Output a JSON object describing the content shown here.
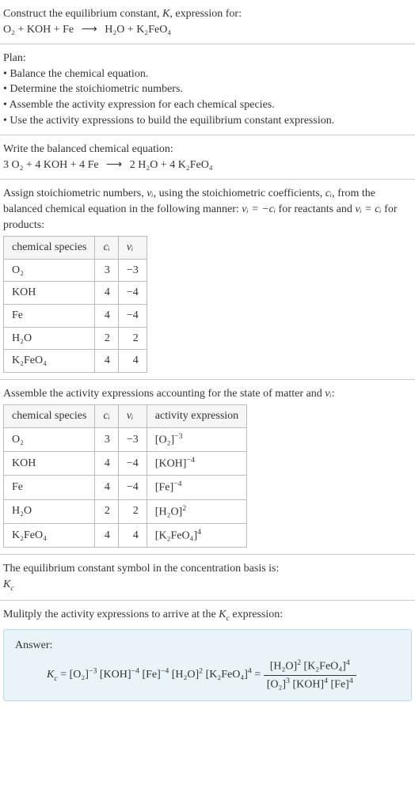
{
  "intro": {
    "line1_a": "Construct the equilibrium constant, ",
    "line1_b": ", expression for:",
    "eq": {
      "left": "O₂ + KOH + Fe",
      "arrow": "⟶",
      "right": "H₂O + K₂FeO₄"
    }
  },
  "plan": {
    "title": "Plan:",
    "items": [
      "• Balance the chemical equation.",
      "• Determine the stoichiometric numbers.",
      "• Assemble the activity expression for each chemical species.",
      "• Use the activity expressions to build the equilibrium constant expression."
    ]
  },
  "balanced": {
    "title": "Write the balanced chemical equation:",
    "eq": {
      "left": "3 O₂ + 4 KOH + 4 Fe",
      "arrow": "⟶",
      "right": "2 H₂O + 4 K₂FeO₄"
    }
  },
  "stoich": {
    "text_a": "Assign stoichiometric numbers, ",
    "text_b": ", using the stoichiometric coefficients, ",
    "text_c": ", from the balanced chemical equation in the following manner: ",
    "text_d": " for reactants and ",
    "text_e": " for products:",
    "nu": "νᵢ",
    "ci": "cᵢ",
    "eq1": "νᵢ = −cᵢ",
    "eq2": "νᵢ = cᵢ",
    "table": {
      "headers": [
        "chemical species",
        "cᵢ",
        "νᵢ"
      ],
      "rows": [
        [
          "O₂",
          "3",
          "−3"
        ],
        [
          "KOH",
          "4",
          "−4"
        ],
        [
          "Fe",
          "4",
          "−4"
        ],
        [
          "H₂O",
          "2",
          "2"
        ],
        [
          "K₂FeO₄",
          "4",
          "4"
        ]
      ]
    }
  },
  "activity": {
    "text_a": "Assemble the activity expressions accounting for the state of matter and ",
    "text_b": ":",
    "nu": "νᵢ",
    "table": {
      "headers": [
        "chemical species",
        "cᵢ",
        "νᵢ",
        "activity expression"
      ],
      "rows": [
        {
          "sp": "O₂",
          "c": "3",
          "v": "−3",
          "act_base": "[O₂]",
          "act_exp": "−3"
        },
        {
          "sp": "KOH",
          "c": "4",
          "v": "−4",
          "act_base": "[KOH]",
          "act_exp": "−4"
        },
        {
          "sp": "Fe",
          "c": "4",
          "v": "−4",
          "act_base": "[Fe]",
          "act_exp": "−4"
        },
        {
          "sp": "H₂O",
          "c": "2",
          "v": "2",
          "act_base": "[H₂O]",
          "act_exp": "2"
        },
        {
          "sp": "K₂FeO₄",
          "c": "4",
          "v": "4",
          "act_base": "[K₂FeO₄]",
          "act_exp": "4"
        }
      ]
    }
  },
  "symbol": {
    "text": "The equilibrium constant symbol in the concentration basis is:",
    "kc": "K",
    "kc_sub": "c"
  },
  "multiply": {
    "text_a": "Mulitply the activity expressions to arrive at the ",
    "text_b": " expression:",
    "kc": "K",
    "kc_sub": "c"
  },
  "answer": {
    "label": "Answer:",
    "kc": "K",
    "kc_sub": "c",
    "eq": " = ",
    "terms": [
      {
        "base": "[O₂]",
        "exp": "−3"
      },
      {
        "base": " [KOH]",
        "exp": "−4"
      },
      {
        "base": " [Fe]",
        "exp": "−4"
      },
      {
        "base": " [H₂O]",
        "exp": "2"
      },
      {
        "base": " [K₂FeO₄]",
        "exp": "4"
      }
    ],
    "eq2": " = ",
    "frac": {
      "num": [
        {
          "base": "[H₂O]",
          "exp": "2"
        },
        {
          "base": " [K₂FeO₄]",
          "exp": "4"
        }
      ],
      "den": [
        {
          "base": "[O₂]",
          "exp": "3"
        },
        {
          "base": " [KOH]",
          "exp": "4"
        },
        {
          "base": " [Fe]",
          "exp": "4"
        }
      ]
    }
  }
}
